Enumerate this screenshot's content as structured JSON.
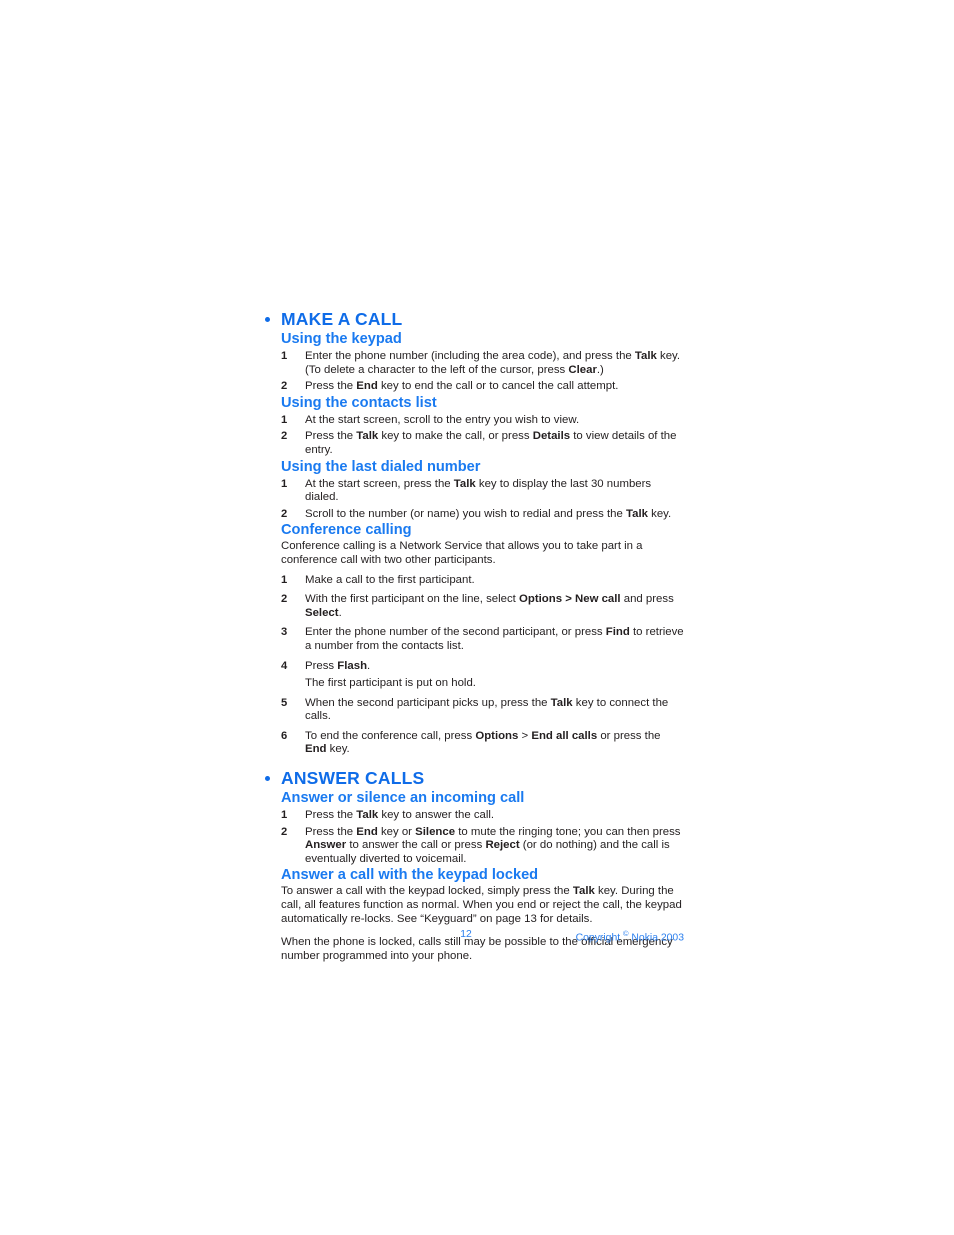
{
  "document": {
    "page_number": "12",
    "footer_copyright_prefix": "Copyright ",
    "footer_copyright_symbol": "©",
    "footer_copyright_suffix": " Nokia 2003",
    "accent_color": "#0f6ce8",
    "heading_color": "#1a7af0",
    "body_color": "#231f20",
    "footer_color": "#2b7fee"
  },
  "sections": [
    {
      "id": "make-a-call",
      "title": "MAKE A CALL",
      "bullet": "bullet-icon",
      "subsections": [
        {
          "id": "using-the-keypad",
          "title": "Using the keypad",
          "steps": [
            {
              "num": "1",
              "parts": [
                {
                  "t": "Enter the phone number (including the area code), and press the ",
                  "b": false
                },
                {
                  "t": "Talk",
                  "b": true
                },
                {
                  "t": " key. (To delete a character to the left of the cursor, press ",
                  "b": false
                },
                {
                  "t": "Clear",
                  "b": true
                },
                {
                  "t": ".)",
                  "b": false
                }
              ]
            },
            {
              "num": "2",
              "parts": [
                {
                  "t": "Press the ",
                  "b": false
                },
                {
                  "t": "End",
                  "b": true
                },
                {
                  "t": " key to end the call or to cancel the call attempt.",
                  "b": false
                }
              ]
            }
          ]
        },
        {
          "id": "using-the-contacts-list",
          "title": "Using the contacts list",
          "steps": [
            {
              "num": "1",
              "parts": [
                {
                  "t": "At the start screen, scroll to the entry you wish to view.",
                  "b": false
                }
              ]
            },
            {
              "num": "2",
              "parts": [
                {
                  "t": "Press the ",
                  "b": false
                },
                {
                  "t": "Talk",
                  "b": true
                },
                {
                  "t": " key to make the call, or press ",
                  "b": false
                },
                {
                  "t": "Details",
                  "b": true
                },
                {
                  "t": " to view details of the entry.",
                  "b": false
                }
              ]
            }
          ]
        },
        {
          "id": "using-the-last-dialed-number",
          "title": "Using the last dialed number",
          "steps": [
            {
              "num": "1",
              "parts": [
                {
                  "t": "At the start screen, press the ",
                  "b": false
                },
                {
                  "t": "Talk",
                  "b": true
                },
                {
                  "t": " key to display the last 30 numbers dialed.",
                  "b": false
                }
              ]
            },
            {
              "num": "2",
              "parts": [
                {
                  "t": "Scroll to the number (or name) you wish to redial and press the ",
                  "b": false
                },
                {
                  "t": "Talk",
                  "b": true
                },
                {
                  "t": " key.",
                  "b": false
                }
              ]
            }
          ]
        },
        {
          "id": "conference-calling",
          "title": "Conference calling",
          "intro": "Conference calling is a Network Service that allows you to take part in a conference call with two other participants.",
          "steps": [
            {
              "num": "1",
              "parts": [
                {
                  "t": "Make a call to the first participant.",
                  "b": false
                }
              ]
            },
            {
              "num": "2",
              "parts": [
                {
                  "t": "With the first participant on the line, select ",
                  "b": false
                },
                {
                  "t": "Options > New call",
                  "b": true
                },
                {
                  "t": " and press ",
                  "b": false
                },
                {
                  "t": "Select",
                  "b": true
                },
                {
                  "t": ".",
                  "b": false
                }
              ]
            },
            {
              "num": "3",
              "parts": [
                {
                  "t": "Enter the phone number of the second participant, or press ",
                  "b": false
                },
                {
                  "t": "Find",
                  "b": true
                },
                {
                  "t": " to retrieve a number from the contacts list.",
                  "b": false
                }
              ]
            },
            {
              "num": "4",
              "parts": [
                {
                  "t": "Press ",
                  "b": false
                },
                {
                  "t": "Flash",
                  "b": true
                },
                {
                  "t": ".",
                  "b": false
                }
              ],
              "sub": "The first participant is put on hold."
            },
            {
              "num": "5",
              "parts": [
                {
                  "t": "When the second participant picks up, press the ",
                  "b": false
                },
                {
                  "t": "Talk",
                  "b": true
                },
                {
                  "t": " key to connect the calls.",
                  "b": false
                }
              ]
            },
            {
              "num": "6",
              "parts": [
                {
                  "t": "To end the conference call, press ",
                  "b": false
                },
                {
                  "t": "Options",
                  "b": true
                },
                {
                  "t": " > ",
                  "b": false
                },
                {
                  "t": "End all calls",
                  "b": true
                },
                {
                  "t": " or press the ",
                  "b": false
                },
                {
                  "t": "End",
                  "b": true
                },
                {
                  "t": " key.",
                  "b": false
                }
              ]
            }
          ]
        }
      ]
    },
    {
      "id": "answer-calls",
      "title": "ANSWER CALLS",
      "bullet": "bullet-icon",
      "subsections": [
        {
          "id": "answer-or-silence-an-incoming-call",
          "title": "Answer or silence an incoming call",
          "steps": [
            {
              "num": "1",
              "parts": [
                {
                  "t": "Press the ",
                  "b": false
                },
                {
                  "t": "Talk",
                  "b": true
                },
                {
                  "t": " key to answer the call.",
                  "b": false
                }
              ]
            },
            {
              "num": "2",
              "parts": [
                {
                  "t": "Press the ",
                  "b": false
                },
                {
                  "t": "End",
                  "b": true
                },
                {
                  "t": " key or ",
                  "b": false
                },
                {
                  "t": "Silence",
                  "b": true
                },
                {
                  "t": " to mute the ringing tone; you can then press ",
                  "b": false
                },
                {
                  "t": "Answer",
                  "b": true
                },
                {
                  "t": " to answer the call or press ",
                  "b": false
                },
                {
                  "t": "Reject",
                  "b": true
                },
                {
                  "t": " (or do nothing) and the call is eventually diverted to voicemail.",
                  "b": false
                }
              ]
            }
          ]
        },
        {
          "id": "answer-a-call-with-the-keypad-locked",
          "title": "Answer a call with the keypad locked",
          "paragraphs": [
            [
              {
                "t": "To answer a call with the keypad locked, simply press the ",
                "b": false
              },
              {
                "t": "Talk",
                "b": true
              },
              {
                "t": " key. During the call, all features function as normal. When you end or reject the call, the keypad automatically re-locks. See “Keyguard” on page 13 for details.",
                "b": false
              }
            ],
            [
              {
                "t": "When the phone is locked, calls still may be possible to the official emergency number programmed into your phone.",
                "b": false
              }
            ]
          ]
        }
      ]
    }
  ]
}
